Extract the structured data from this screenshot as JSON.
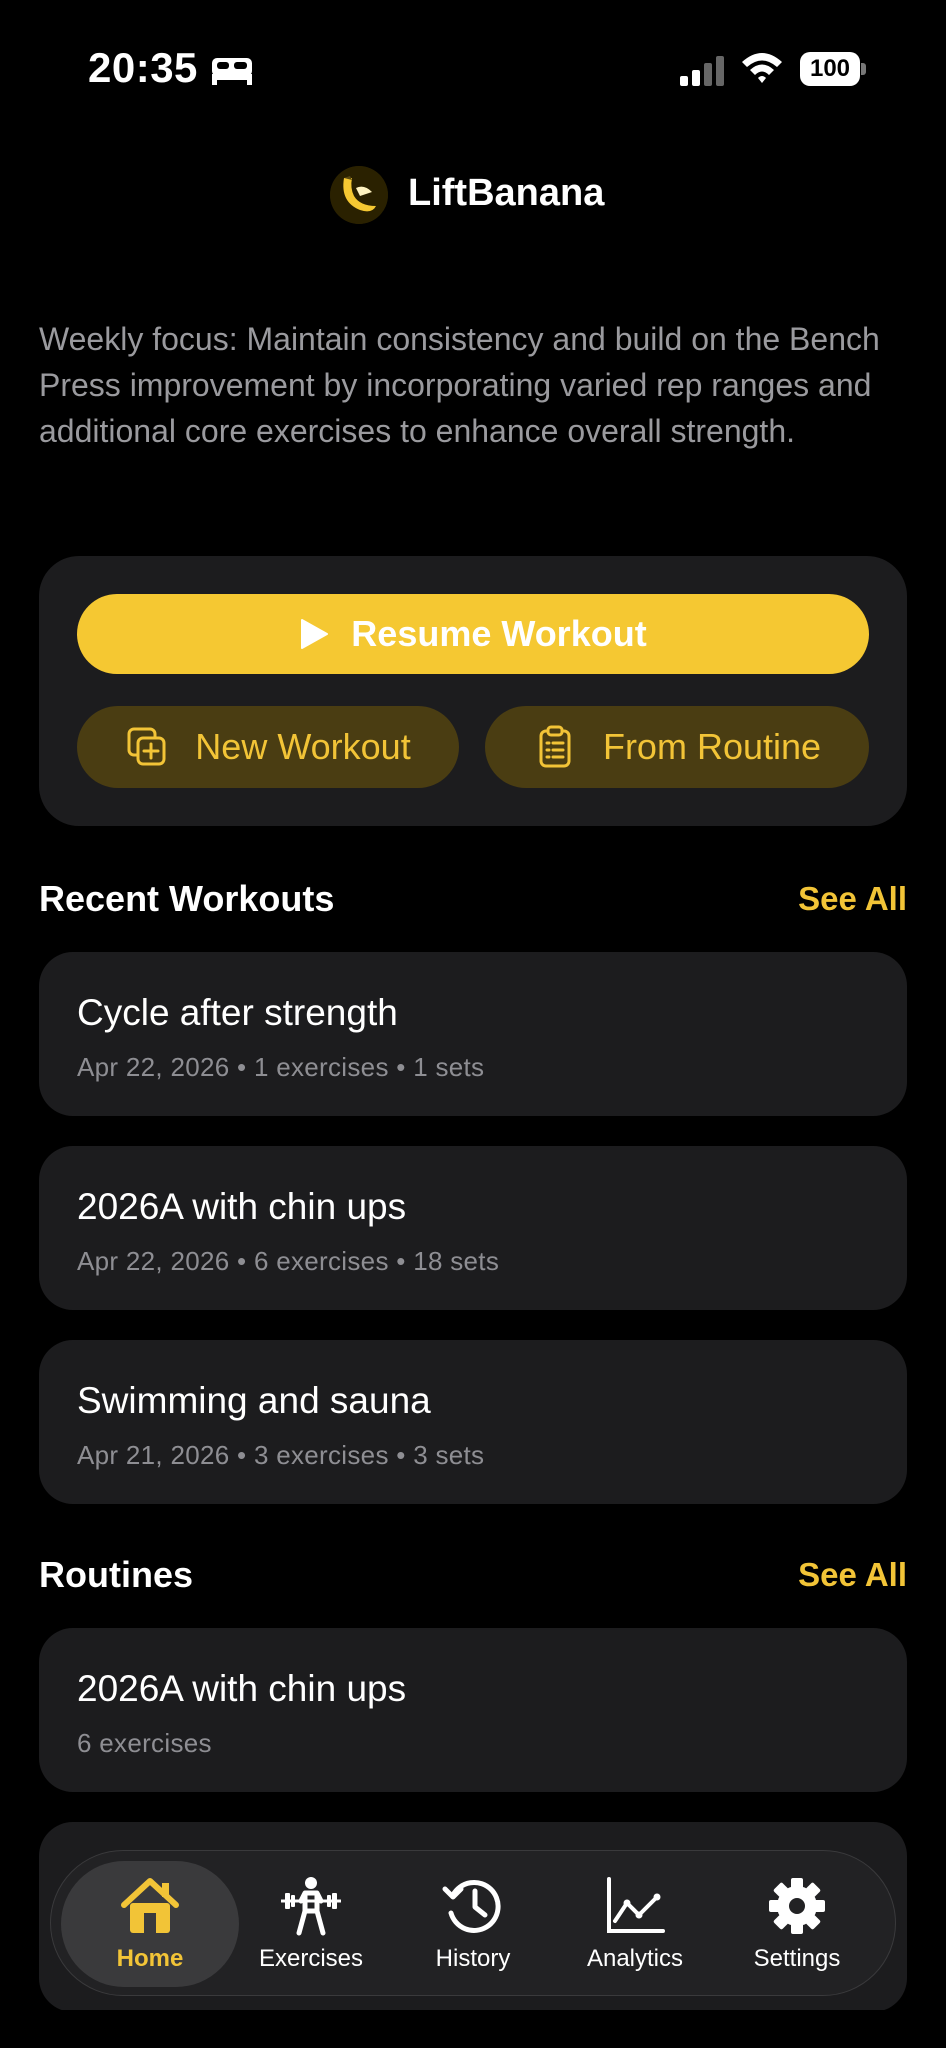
{
  "status_bar": {
    "time": "20:35",
    "battery": "100"
  },
  "app": {
    "title": "LiftBanana"
  },
  "focus": {
    "text": "Weekly focus: Maintain consistency and build on the Bench Press improvement by incorporating varied rep ranges and additional core exercises to enhance overall strength."
  },
  "actions": {
    "resume_label": "Resume Workout",
    "new_label": "New Workout",
    "routine_label": "From Routine"
  },
  "recent": {
    "title": "Recent Workouts",
    "see_all": "See All",
    "items": [
      {
        "title": "Cycle after strength",
        "meta": "Apr 22, 2026 • 1 exercises • 1 sets"
      },
      {
        "title": "2026A with chin ups",
        "meta": "Apr 22, 2026 • 6 exercises • 18 sets"
      },
      {
        "title": "Swimming and sauna",
        "meta": "Apr 21, 2026 • 3 exercises • 3 sets"
      }
    ]
  },
  "routines": {
    "title": "Routines",
    "see_all": "See All",
    "items": [
      {
        "title": "2026A with chin ups",
        "meta": "6 exercises"
      }
    ]
  },
  "tabs": [
    {
      "label": "Home",
      "icon": "home-icon",
      "active": true
    },
    {
      "label": "Exercises",
      "icon": "weightlifter-icon",
      "active": false
    },
    {
      "label": "History",
      "icon": "history-icon",
      "active": false
    },
    {
      "label": "Analytics",
      "icon": "chart-icon",
      "active": false
    },
    {
      "label": "Settings",
      "icon": "gear-icon",
      "active": false
    }
  ],
  "colors": {
    "accent": "#f5c832",
    "accent_text": "#f2c437",
    "card": "#1c1c1e",
    "background": "#000000"
  }
}
